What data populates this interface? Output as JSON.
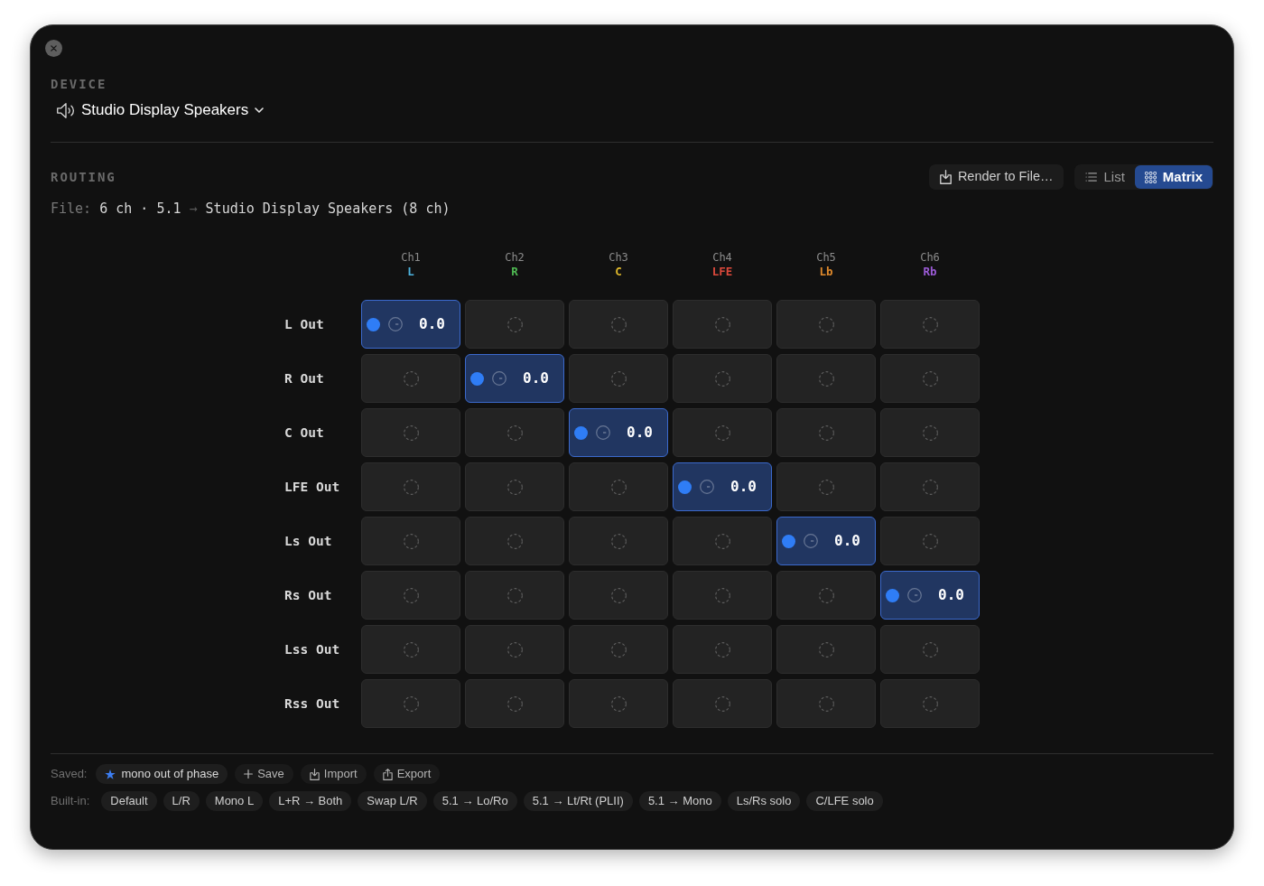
{
  "device": {
    "label": "DEVICE",
    "name": "Studio Display Speakers"
  },
  "routing": {
    "label": "ROUTING",
    "render_button": "Render to File…",
    "view_tabs": [
      {
        "kind": "list",
        "label": "List",
        "selected": false
      },
      {
        "kind": "matrix",
        "label": "Matrix",
        "selected": true
      }
    ],
    "file": {
      "label": "File:",
      "source": "6 ch · 5.1",
      "arrow": "→",
      "target": "Studio Display Speakers (8 ch)"
    }
  },
  "matrix": {
    "columns": [
      {
        "channel": "Ch1",
        "name": "L",
        "color": "#4db3df"
      },
      {
        "channel": "Ch2",
        "name": "R",
        "color": "#4fb952"
      },
      {
        "channel": "Ch3",
        "name": "C",
        "color": "#e2bb2c"
      },
      {
        "channel": "Ch4",
        "name": "LFE",
        "color": "#de4a3c"
      },
      {
        "channel": "Ch5",
        "name": "Lb",
        "color": "#e08a2c"
      },
      {
        "channel": "Ch6",
        "name": "Rb",
        "color": "#9b5bd6"
      }
    ],
    "rows": [
      {
        "label": "L Out",
        "cells": [
          {
            "on": true,
            "gain": "0.0"
          },
          {
            "on": false
          },
          {
            "on": false
          },
          {
            "on": false
          },
          {
            "on": false
          },
          {
            "on": false
          }
        ]
      },
      {
        "label": "R Out",
        "cells": [
          {
            "on": false
          },
          {
            "on": true,
            "gain": "0.0"
          },
          {
            "on": false
          },
          {
            "on": false
          },
          {
            "on": false
          },
          {
            "on": false
          }
        ]
      },
      {
        "label": "C Out",
        "cells": [
          {
            "on": false
          },
          {
            "on": false
          },
          {
            "on": true,
            "gain": "0.0"
          },
          {
            "on": false
          },
          {
            "on": false
          },
          {
            "on": false
          }
        ]
      },
      {
        "label": "LFE Out",
        "cells": [
          {
            "on": false
          },
          {
            "on": false
          },
          {
            "on": false
          },
          {
            "on": true,
            "gain": "0.0"
          },
          {
            "on": false
          },
          {
            "on": false
          }
        ]
      },
      {
        "label": "Ls Out",
        "cells": [
          {
            "on": false
          },
          {
            "on": false
          },
          {
            "on": false
          },
          {
            "on": false
          },
          {
            "on": true,
            "gain": "0.0"
          },
          {
            "on": false
          }
        ]
      },
      {
        "label": "Rs Out",
        "cells": [
          {
            "on": false
          },
          {
            "on": false
          },
          {
            "on": false
          },
          {
            "on": false
          },
          {
            "on": false
          },
          {
            "on": true,
            "gain": "0.0"
          }
        ]
      },
      {
        "label": "Lss Out",
        "cells": [
          {
            "on": false
          },
          {
            "on": false
          },
          {
            "on": false
          },
          {
            "on": false
          },
          {
            "on": false
          },
          {
            "on": false
          }
        ]
      },
      {
        "label": "Rss Out",
        "cells": [
          {
            "on": false
          },
          {
            "on": false
          },
          {
            "on": false
          },
          {
            "on": false
          },
          {
            "on": false
          },
          {
            "on": false
          }
        ]
      }
    ]
  },
  "presets": {
    "saved_label": "Saved:",
    "saved": [
      {
        "label": "mono out of phase"
      }
    ],
    "actions": [
      {
        "kind": "save",
        "label": "Save"
      },
      {
        "kind": "import",
        "label": "Import"
      },
      {
        "kind": "export",
        "label": "Export"
      }
    ],
    "builtin_label": "Built-in:",
    "builtin": [
      "Default",
      "L/R",
      "Mono L",
      "L+R → Both",
      "Swap L/R",
      "5.1 → Lo/Ro",
      "5.1 → Lt/Rt (PLII)",
      "5.1 → Mono",
      "Ls/Rs solo",
      "C/LFE solo"
    ]
  }
}
